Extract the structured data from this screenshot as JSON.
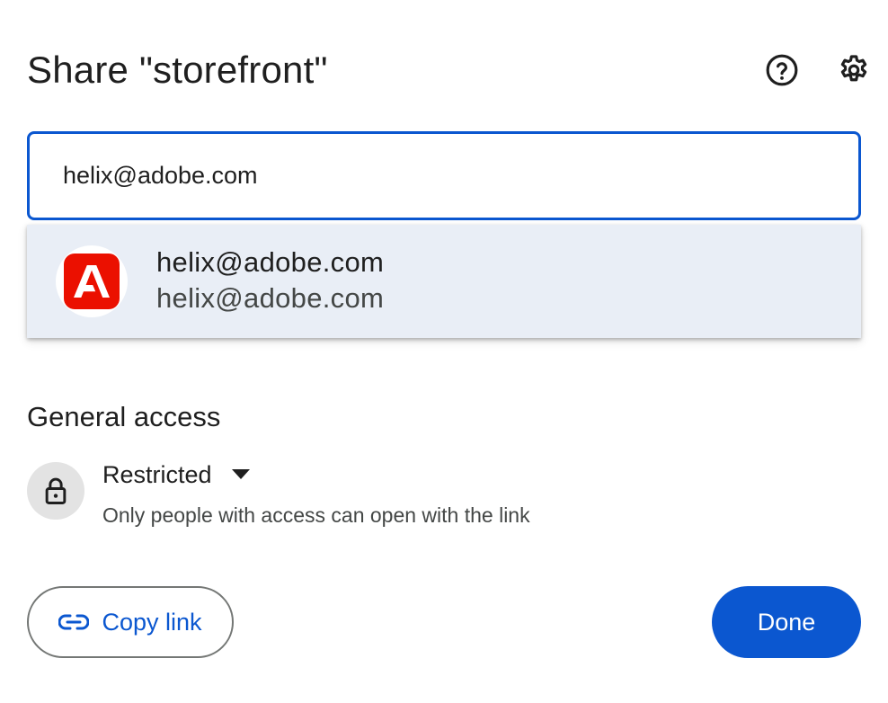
{
  "dialog": {
    "title": "Share \"storefront\""
  },
  "header_icons": {
    "help": "help-circle-icon",
    "settings": "gear-icon"
  },
  "recipient_input": {
    "value": "helix@adobe.com",
    "placeholder": ""
  },
  "suggestion": {
    "name": "helix@adobe.com",
    "email": "helix@adobe.com",
    "avatar_icon": "adobe-logo-icon"
  },
  "general_access": {
    "title": "General access",
    "level": "Restricted",
    "description": "Only people with access can open with the link",
    "icon": "lock-icon"
  },
  "actions": {
    "copy_link": "Copy link",
    "done": "Done"
  },
  "colors": {
    "accent": "#0b57d0",
    "suggestion_bg": "#e9eef6",
    "adobe_red": "#eb1000",
    "lock_bg": "#e3e3e3"
  }
}
